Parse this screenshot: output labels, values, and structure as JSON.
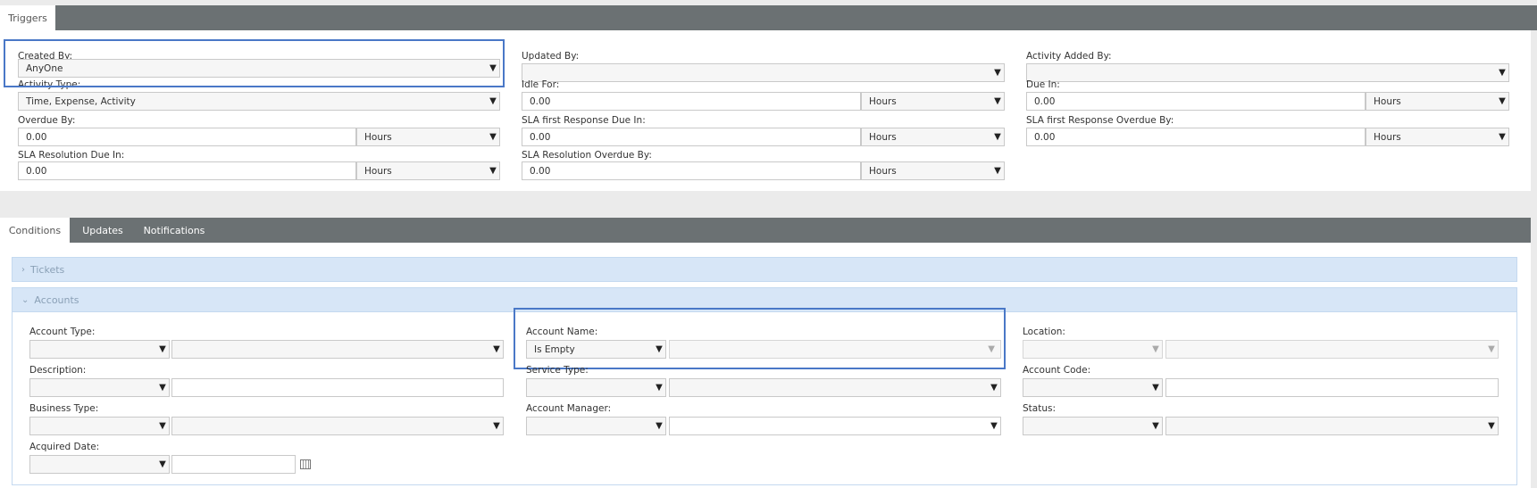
{
  "top_tabs": [
    "Triggers"
  ],
  "triggers": {
    "created_by": {
      "label": "Created By:",
      "value": "AnyOne"
    },
    "updated_by": {
      "label": "Updated By:",
      "value": ""
    },
    "activity_added_by": {
      "label": "Activity Added By:",
      "value": ""
    },
    "activity_type": {
      "label": "Activity Type:",
      "value": "Time, Expense, Activity"
    },
    "idle_for": {
      "label": "Idle For:",
      "value": "0.00",
      "unit": "Hours"
    },
    "due_in": {
      "label": "Due In:",
      "value": "0.00",
      "unit": "Hours"
    },
    "overdue_by": {
      "label": "Overdue By:",
      "value": "0.00",
      "unit": "Hours"
    },
    "sla_first_response_due_in": {
      "label": "SLA first Response Due In:",
      "value": "0.00",
      "unit": "Hours"
    },
    "sla_first_response_overdue_by": {
      "label": "SLA first Response Overdue By:",
      "value": "0.00",
      "unit": "Hours"
    },
    "sla_resolution_due_in": {
      "label": "SLA Resolution Due In:",
      "value": "0.00",
      "unit": "Hours"
    },
    "sla_resolution_overdue_by": {
      "label": "SLA Resolution Overdue By:",
      "value": "0.00",
      "unit": "Hours"
    }
  },
  "lower_tabs": [
    "Conditions",
    "Updates",
    "Notifications"
  ],
  "sections": {
    "tickets": "Tickets",
    "accounts": "Accounts"
  },
  "accounts": {
    "account_type": {
      "label": "Account Type:"
    },
    "account_name": {
      "label": "Account Name:",
      "operator": "Is Empty"
    },
    "location": {
      "label": "Location:"
    },
    "description": {
      "label": "Description:"
    },
    "service_type": {
      "label": "Service Type:"
    },
    "account_code": {
      "label": "Account Code:"
    },
    "business_type": {
      "label": "Business Type:"
    },
    "account_manager": {
      "label": "Account Manager:"
    },
    "status": {
      "label": "Status:"
    },
    "acquired_date": {
      "label": "Acquired Date:"
    }
  },
  "icons": {
    "dropdown": "caret-down-icon",
    "collapsed": "chevron-right-icon",
    "expanded": "chevron-down-icon",
    "calendar": "calendar-icon"
  },
  "colors": {
    "tab_bar": "#6b7173",
    "section_header": "#d7e6f7",
    "highlight": "#4a78c7"
  }
}
